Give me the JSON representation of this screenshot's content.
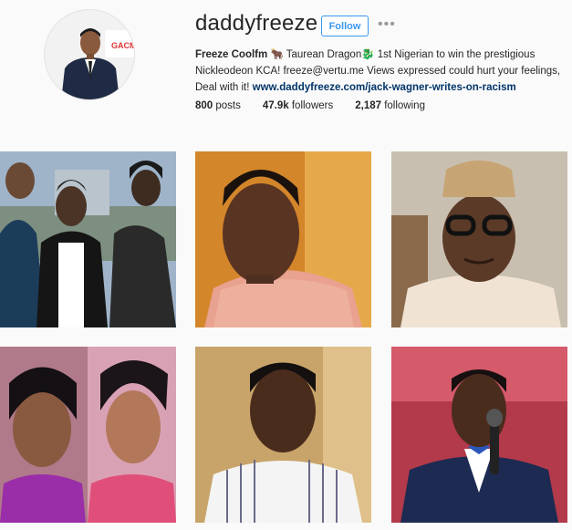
{
  "profile": {
    "username": "daddyfreeze",
    "follow_label": "Follow",
    "more_label": "•••",
    "bio": {
      "name": "Freeze Coolfm",
      "text_1": " 🐂 Taurean Dragon🐉 1st Nigerian to win the prestigious Nickleodeon KCA! freeze@vertu.me Views expressed could hurt your feelings, Deal with it! ",
      "link": "www.daddyfreeze.com/jack-wagner-writes-on-racism"
    },
    "stats": {
      "posts_count": "800",
      "posts_label": " posts",
      "followers_count": "47.9k",
      "followers_label": " followers",
      "following_count": "2,187",
      "following_label": " following"
    }
  },
  "avatar": {
    "logo_text": "GACM"
  }
}
